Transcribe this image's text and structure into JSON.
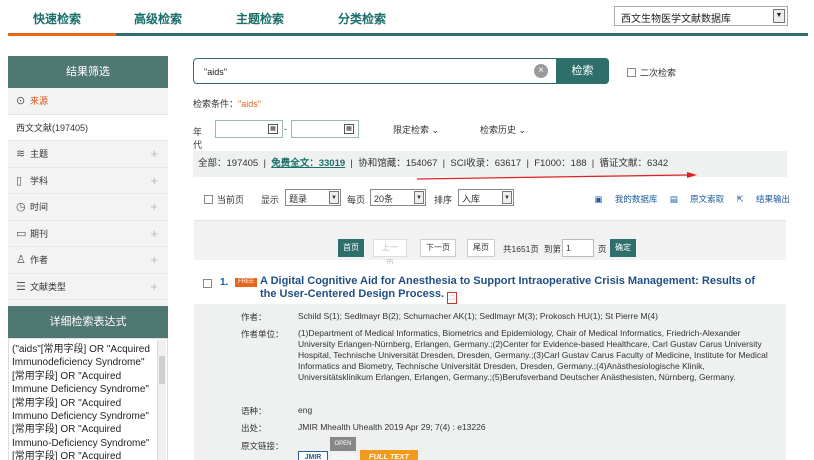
{
  "topbar": {
    "tabs": [
      "快速检索",
      "高级检索",
      "主题检索",
      "分类检索"
    ],
    "db_select": "西文生物医学文献数据库"
  },
  "sidebar": {
    "filter_title": "结果筛选",
    "source_label": "来源",
    "source_item": "西文文献(197405)",
    "facets": [
      "主题",
      "学科",
      "时间",
      "期刊",
      "作者",
      "文献类型"
    ],
    "detail_title": "详细检索表达式",
    "expression": "(\"aids\"[常用字段] OR \"Acquired Immunodeficiency Syndrome\"[常用字段] OR \"Acquired Immune Deficiency Syndrome\"[常用字段] OR \"Acquired Immuno Deficiency Syndrome\"[常用字段] OR \"Acquired Immuno-Deficiency Syndrome\"[常用字段] OR \"Acquired"
  },
  "search": {
    "value": "\"aids\"",
    "button": "检索",
    "secondary": "二次检索"
  },
  "condition": {
    "label": "检索条件：",
    "query": "\"aids\""
  },
  "year": {
    "label": "年代",
    "dash": "-",
    "limit": "限定检索",
    "history": "检索历史"
  },
  "stats": {
    "all": "全部：197405",
    "free": "免费全文：33019",
    "xiezhu": "协和馆藏：154067",
    "sci": "SCI收录：63617",
    "f1000": "F1000：188",
    "xunzheng": "循证文献：6342"
  },
  "toolbar": {
    "current_page": "当前页",
    "display": "显示",
    "display_value": "题录",
    "per_page": "每页",
    "per_page_value": "20条",
    "sort": "排序",
    "sort_value": "入库",
    "my_db": "我的数据库",
    "fulltext_req": "原文索取",
    "export": "结果输出"
  },
  "pager": {
    "first": "首页",
    "prev": "上一页",
    "next": "下一页",
    "last": "尾页",
    "total": "共1651页",
    "goto": "到第",
    "page_value": "1",
    "page_unit": "页",
    "confirm": "确定"
  },
  "result": {
    "number": "1.",
    "badge": "FREE",
    "title": "A Digital Cognitive Aid for Anesthesia to Support Intraoperative Crisis Management: Results of the User-Centered Design Process.",
    "authors_label": "作者：",
    "authors": "Schild S(1);  Sedlmayr B(2);  Schumacher AK(1);  Sedlmayr M(3);  Prokosch HU(1);  St Pierre M(4)",
    "affil_label": "作者单位：",
    "affiliation": "(1)Department of Medical Informatics, Biometrics and Epidemiology, Chair of Medical Informatics, Friedrich-Alexander University Erlangen-Nürnberg, Erlangen, Germany.;(2)Center for Evidence-based Healthcare, Carl Gustav Carus University Hospital, Technische Universität Dresden, Dresden, Germany.;(3)Carl Gustav Carus Faculty of Medicine, Institute for Medical Informatics and Biometry, Technische Universität Dresden, Dresden, Germany.;(4)Anästhesiologische Klinik, Universitätsklinikum Erlangen, Erlangen, Germany.;(5)Berufsverband Deutscher Anästhesisten, Nürnberg, Germany.",
    "lang_label": "语种：",
    "lang": "eng",
    "source_label": "出处：",
    "source": "JMIR Mhealth Uhealth  2019 Apr 29; 7(4) : e13226",
    "link_label": "原文链接：",
    "jmir": "JMIR",
    "oa": "OPEN ACCESS",
    "fulltext": "FULL TEXT"
  }
}
